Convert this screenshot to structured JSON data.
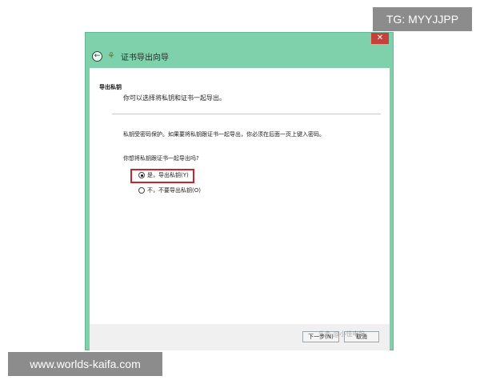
{
  "watermarks": {
    "top_right": "TG: MYYJJPP",
    "bottom_left": "www.worlds-kaifa.com"
  },
  "window": {
    "close_label": "✕",
    "title": "证书导出向导",
    "back_icon_glyph": "←",
    "cert_icon_glyph": "⚘"
  },
  "page": {
    "section_title": "导出私钥",
    "section_desc": "你可以选择将私钥和证书一起导出。",
    "info_text": "私钥受密码保护。如果要将私钥跟证书一起导出，你必须在后面一页上键入密码。",
    "question": "你想将私钥跟证书一起导出吗?",
    "options": [
      {
        "label": "是，导出私钥(Y)",
        "checked": true
      },
      {
        "label": "不，不要导出私钥(O)",
        "checked": false
      }
    ]
  },
  "footer": {
    "next_label": "下一步(N)",
    "cancel_label": "取消",
    "overlay_text": "头条 @小佳电脑"
  },
  "colors": {
    "window_frame": "#7fd1ac",
    "close_button": "#c7413a",
    "highlight": "#c9252c"
  }
}
